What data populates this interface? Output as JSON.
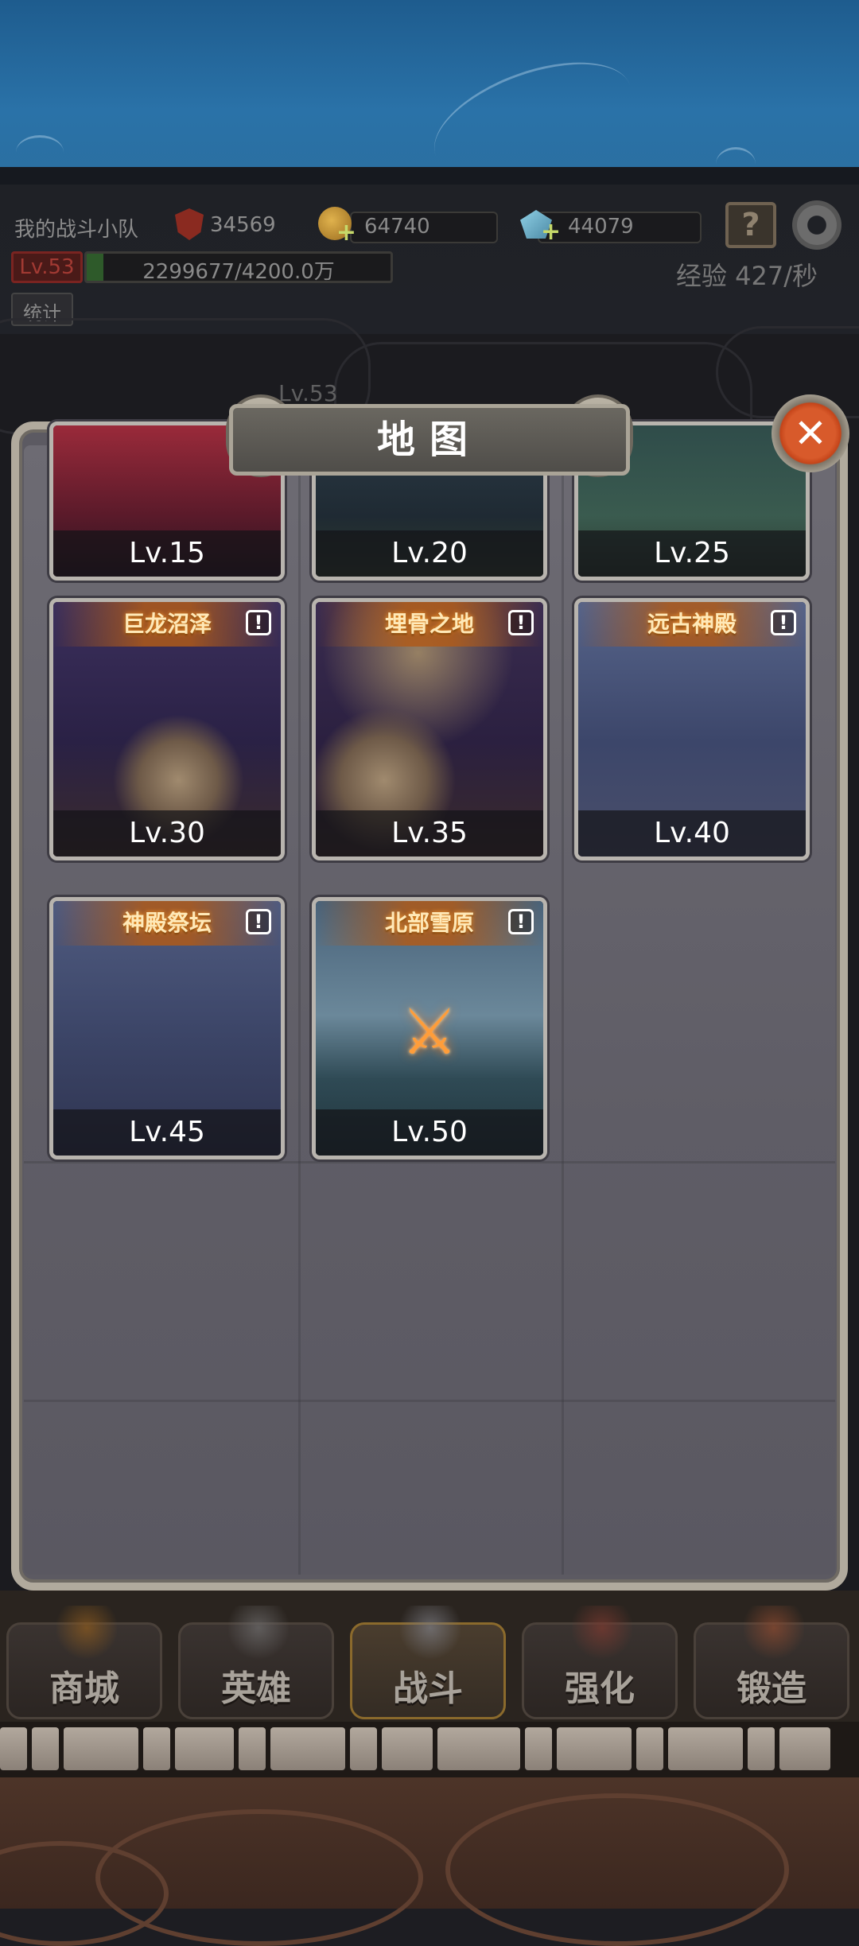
{
  "hud": {
    "team_name": "我的战斗小队",
    "power": "34569",
    "gold": "64740",
    "gems": "44079",
    "level_badge": "Lv.53",
    "exp_progress_text": "2299677/4200.0万",
    "exp_progress_fraction": 0.055,
    "stats_label": "统计",
    "exp_rate": "经验 427/秒",
    "bg_level_tag": "Lv.53",
    "help_icon": "book-question-icon",
    "settings_icon": "gear-icon"
  },
  "dialog": {
    "title": "地图",
    "close_icon": "close-icon"
  },
  "maps": [
    {
      "name": "",
      "level": "Lv.15"
    },
    {
      "name": "",
      "level": "Lv.20"
    },
    {
      "name": "",
      "level": "Lv.25"
    },
    {
      "name": "巨龙沼泽",
      "level": "Lv.30"
    },
    {
      "name": "埋骨之地",
      "level": "Lv.35"
    },
    {
      "name": "远古神殿",
      "level": "Lv.40"
    },
    {
      "name": "神殿祭坛",
      "level": "Lv.45"
    },
    {
      "name": "北部雪原",
      "level": "Lv.50",
      "current": true
    }
  ],
  "nav": [
    {
      "label": "商城",
      "icon": "treasure-chest-icon"
    },
    {
      "label": "英雄",
      "icon": "viking-helmet-icon"
    },
    {
      "label": "战斗",
      "icon": "crossed-swords-icon",
      "active": true
    },
    {
      "label": "强化",
      "icon": "hammer-icon"
    },
    {
      "label": "锻造",
      "icon": "forge-icon"
    }
  ],
  "colors": {
    "accent_orange": "#f07d2a",
    "close_red": "#d85a2b",
    "frame_stone": "#b1aa9d",
    "exp_green": "#2e5a2a"
  }
}
